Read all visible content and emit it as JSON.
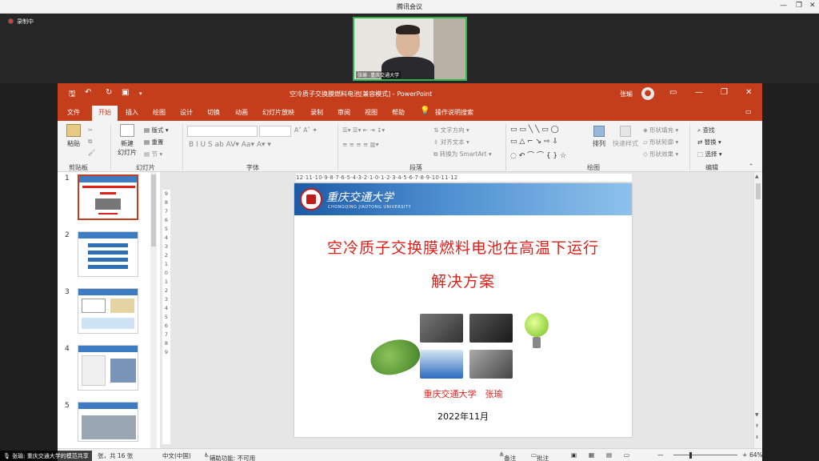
{
  "meeting": {
    "title": "腾讯会议",
    "recording": "录制中",
    "participant_label": "张瑜 -重庆交通大学"
  },
  "ppt": {
    "doc_title": "空冷质子交换膜燃料电池[兼容模式] - PowerPoint",
    "user_name": "张瑜",
    "tabs": [
      "文件",
      "开始",
      "插入",
      "绘图",
      "设计",
      "切换",
      "动画",
      "幻灯片放映",
      "录制",
      "审阅",
      "视图",
      "帮助"
    ],
    "tell_me": "操作说明搜索",
    "ribbon": {
      "paste": "粘贴",
      "new_slide_1": "新建",
      "new_slide_2": "幻灯片",
      "layout": "版式",
      "reset": "重置",
      "section": "节",
      "text_direction": "文字方向",
      "align_text": "对齐文本",
      "smartart": "转换为 SmartArt",
      "arrange": "排列",
      "quick_styles": "快速样式",
      "shape_fill": "形状填充",
      "shape_outline": "形状轮廓",
      "shape_effects": "形状效果",
      "find": "查找",
      "replace": "替换",
      "select": "选择"
    },
    "groups": [
      "剪贴板",
      "幻灯片",
      "字体",
      "段落",
      "绘图",
      "编辑"
    ],
    "slide_numbers": [
      "1",
      "2",
      "3",
      "4",
      "5"
    ],
    "ruler_h": "12·11·10·9·8·7·6·5·4·3·2·1·0·1·2·3·4·5·6·7·8·9·10·11·12",
    "slide": {
      "title_line1": "空冷质子交换膜燃料电池在高温下运行",
      "title_line2": "解决方案",
      "author": "重庆交通大学　张瑜",
      "date": "2022年11月"
    },
    "status": {
      "slide_count": "张，共 16 张",
      "language": "中文(中国)",
      "accessibility": "辅助功能: 不可用",
      "notes": "备注",
      "comments": "批注",
      "zoom": "64%"
    }
  },
  "speaker_bar": "张瑜: 重庆交通大学的模范共享",
  "colors": {
    "accent": "#c43e1c",
    "title_red": "#e0201b",
    "cam_border": "#2fb34a"
  }
}
